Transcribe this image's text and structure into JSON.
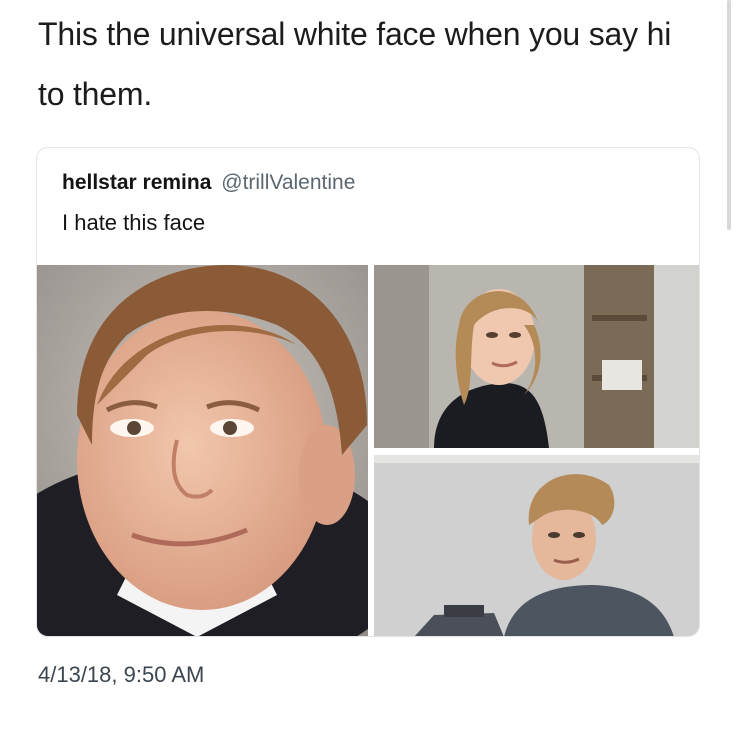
{
  "post": {
    "caption": "This the universal white face when you say hi to them."
  },
  "tweet": {
    "author_name": "hellstar remina",
    "author_handle": "@trillValentine",
    "text": "I hate this face",
    "timestamp": "4/13/18, 9:50 AM",
    "media": [
      {
        "subject": "boy-school-portrait"
      },
      {
        "subject": "girl-over-shoulder"
      },
      {
        "subject": "man-over-shoulder"
      }
    ]
  },
  "colors": {
    "text": "#1c1c1c",
    "handle": "#5b6670",
    "card_border": "#e3e3e3",
    "timestamp": "#3c4650"
  }
}
